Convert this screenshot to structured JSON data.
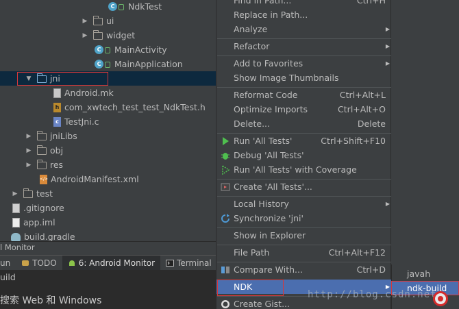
{
  "project_tree": {
    "rows": [
      {
        "label": "NdkTest",
        "icon": "class-icon"
      },
      {
        "label": "ui",
        "icon": "folder-icon"
      },
      {
        "label": "widget",
        "icon": "folder-icon"
      },
      {
        "label": "MainActivity",
        "icon": "class-icon"
      },
      {
        "label": "MainApplication",
        "icon": "class-icon"
      },
      {
        "label": "jni",
        "icon": "folder-icon"
      },
      {
        "label": "Android.mk",
        "icon": "file-icon"
      },
      {
        "label": "com_xwtech_test_test_NdkTest.h",
        "icon": "header-file-icon"
      },
      {
        "label": "TestJni.c",
        "icon": "c-file-icon"
      },
      {
        "label": "jniLibs",
        "icon": "folder-icon"
      },
      {
        "label": "obj",
        "icon": "folder-icon"
      },
      {
        "label": "res",
        "icon": "folder-icon"
      },
      {
        "label": "AndroidManifest.xml",
        "icon": "xml-file-icon"
      },
      {
        "label": "test",
        "icon": "folder-icon"
      },
      {
        "label": ".gitignore",
        "icon": "file-icon"
      },
      {
        "label": "app.iml",
        "icon": "file-icon"
      },
      {
        "label": "build.gradle",
        "icon": "gradle-icon"
      }
    ]
  },
  "tool_window": {
    "title": "l Monitor",
    "tabs": [
      {
        "label": "un",
        "icon": "run-icon"
      },
      {
        "label": "TODO",
        "icon": "todo-icon"
      },
      {
        "label": "6: Android Monitor",
        "icon": "android-icon"
      },
      {
        "label": "Terminal",
        "icon": "terminal-icon"
      }
    ],
    "content_text": "uild",
    "search_text": "搜索 Web 和 Windows"
  },
  "context_menu": {
    "items": [
      {
        "label": "Find in Path...",
        "shortcut": "Ctrl+H"
      },
      {
        "label": "Replace in Path...",
        "shortcut": ""
      },
      {
        "label": "Analyze",
        "shortcut": "",
        "submenu": true
      },
      {
        "label": "Refactor",
        "shortcut": "",
        "submenu": true
      },
      {
        "label": "Add to Favorites",
        "shortcut": "",
        "submenu": true
      },
      {
        "label": "Show Image Thumbnails",
        "shortcut": ""
      },
      {
        "label": "Reformat Code",
        "shortcut": "Ctrl+Alt+L"
      },
      {
        "label": "Optimize Imports",
        "shortcut": "Ctrl+Alt+O"
      },
      {
        "label": "Delete...",
        "shortcut": "Delete"
      },
      {
        "label": "Run 'All Tests'",
        "shortcut": "Ctrl+Shift+F10"
      },
      {
        "label": "Debug 'All Tests'",
        "shortcut": ""
      },
      {
        "label": "Run 'All Tests' with Coverage",
        "shortcut": ""
      },
      {
        "label": "Create 'All Tests'...",
        "shortcut": ""
      },
      {
        "label": "Local History",
        "shortcut": "",
        "submenu": true
      },
      {
        "label": "Synchronize 'jni'",
        "shortcut": ""
      },
      {
        "label": "Show in Explorer",
        "shortcut": ""
      },
      {
        "label": "File Path",
        "shortcut": "Ctrl+Alt+F12"
      },
      {
        "label": "Compare With...",
        "shortcut": "Ctrl+D"
      },
      {
        "label": "NDK",
        "shortcut": "",
        "submenu": true
      },
      {
        "label": "Create Gist...",
        "shortcut": ""
      }
    ]
  },
  "ndk_submenu": {
    "items": [
      {
        "label": "javah"
      },
      {
        "label": "ndk-build"
      }
    ]
  },
  "watermark": "http://blog.csdn.net/",
  "colors": {
    "background": "#3c3f41",
    "selection": "#4b6eaf",
    "tree_selection": "#0d293e",
    "annotation_red": "#d6383b"
  }
}
